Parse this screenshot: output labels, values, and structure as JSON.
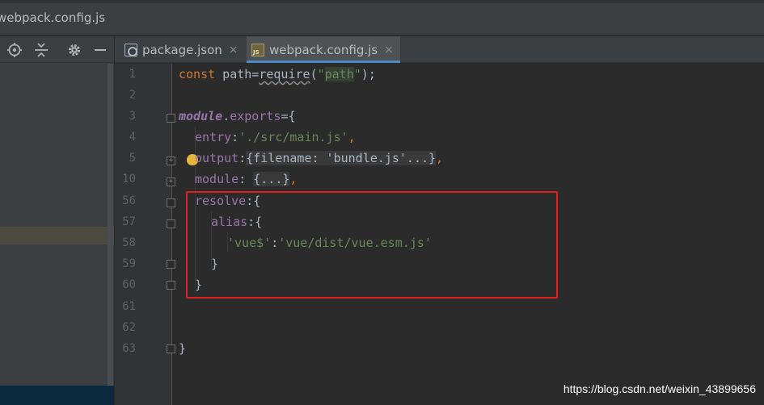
{
  "window": {
    "title": "webpack.config.js"
  },
  "left_panel": {
    "toolbar_icons": [
      "crosshair-icon",
      "collapse-icon",
      "gear-icon",
      "minimize-icon"
    ]
  },
  "tabs": [
    {
      "label": "package.json",
      "icon": "json-file-icon",
      "close": "×",
      "active": false
    },
    {
      "label": "webpack.config.js",
      "icon": "js-file-icon",
      "close": "×",
      "active": true
    }
  ],
  "editor": {
    "line_numbers": [
      "1",
      "2",
      "3",
      "4",
      "5",
      "10",
      "56",
      "57",
      "58",
      "59",
      "60",
      "61",
      "62",
      "63"
    ],
    "lines": {
      "l1": {
        "kw": "const",
        "rest": " path=",
        "req": "require",
        "paren_open": "(",
        "q1": "\"",
        "path": "path",
        "q2": "\"",
        "end": ");"
      },
      "l3": {
        "mod": "module",
        "dot": ".",
        "exports": "exports",
        "end": "={"
      },
      "l4": {
        "prop": "entry",
        "colon": ":",
        "str": "'./src/main.js'",
        "comma": ","
      },
      "l5": {
        "prop": "output",
        "colon": ":",
        "folded": "{filename: 'bundle.js'...}",
        "comma": ","
      },
      "l10": {
        "prop": "module",
        "colon": ": ",
        "folded": "{...}",
        "comma": ","
      },
      "l56": {
        "prop": "resolve",
        "rest": ":{"
      },
      "l57": {
        "prop": "alias",
        "rest": ":{"
      },
      "l58": {
        "key": "'vue$'",
        "colon": ":",
        "val": "'vue/dist/vue.esm.js'"
      },
      "l59": {
        "text": "}"
      },
      "l60": {
        "text": "}"
      },
      "l63": {
        "text": "}"
      }
    }
  },
  "watermark": "https://blog.csdn.net/weixin_43899656",
  "colors": {
    "keyword": "#cc7832",
    "string": "#6a8759",
    "property": "#9876aa",
    "highlight_box": "#e02020",
    "active_tab_underline": "#4a88c7"
  }
}
